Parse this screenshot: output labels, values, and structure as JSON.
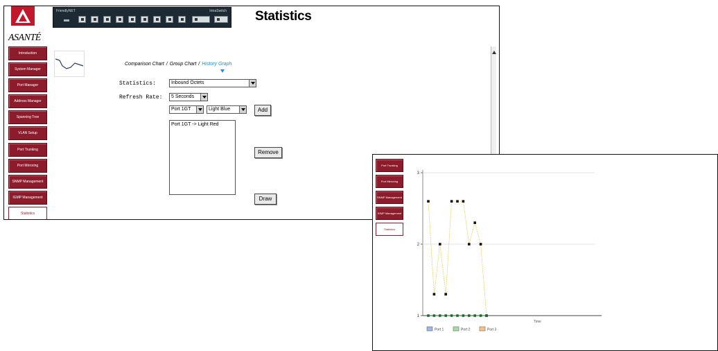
{
  "app": {
    "logo_text": "ASANTÉ",
    "title": "Statistics"
  },
  "device": {
    "brand": "FriendlyNET",
    "model": "IntraSwitch"
  },
  "nav": {
    "items": [
      "Introduction",
      "System Manager",
      "Port Manager",
      "Address Manager",
      "Spanning Tree",
      "VLAN Setup",
      "Port Trunking",
      "Port Mirroring",
      "SNMP Management",
      "IGMP Management",
      "Statistics"
    ],
    "active": "Statistics"
  },
  "breadcrumb": {
    "items": [
      "Comparison Chart",
      "Group Chart"
    ],
    "current": "History Graph"
  },
  "form": {
    "statistics_label": "Statistics:",
    "statistics_value": "Inbound Octets",
    "refresh_label": "Refresh Rate:",
    "refresh_value": "5 Seconds",
    "port_value": "Port 1GT",
    "color_value": "Light Blue",
    "add_label": "Add",
    "remove_label": "Remove",
    "draw_label": "Draw",
    "list_items": [
      "Port 1GT -> Light Red"
    ]
  },
  "chart_window": {
    "nav_items": [
      "Port Trunking",
      "Port Mirroring",
      "SNMP Management",
      "IGMP Management",
      "Statistics"
    ],
    "active": "Statistics"
  },
  "chart_data": {
    "type": "line",
    "x": [
      1,
      2,
      3,
      4,
      5,
      6,
      7,
      8,
      9,
      10,
      11
    ],
    "yticks": [
      "1",
      "2",
      "3"
    ],
    "ylim": [
      1,
      3
    ],
    "series": [
      {
        "name": "Port 1",
        "color": "#f0c84a",
        "values": [
          2.6,
          1.3,
          2.0,
          1.3,
          2.6,
          2.6,
          2.6,
          2.0,
          2.3,
          2.0,
          1.0
        ]
      },
      {
        "name": "Port 2",
        "color": "#1e6b2c",
        "values": [
          1,
          1,
          1,
          1,
          1,
          1,
          1,
          1,
          1,
          1,
          1
        ]
      }
    ],
    "xlabel": "Time",
    "legend": [
      {
        "label": "Port 1",
        "color": "#9fb8e8"
      },
      {
        "label": "Port 2",
        "color": "#a8dca8"
      },
      {
        "label": "Port 3",
        "color": "#f2c48a"
      }
    ],
    "grid": true
  }
}
